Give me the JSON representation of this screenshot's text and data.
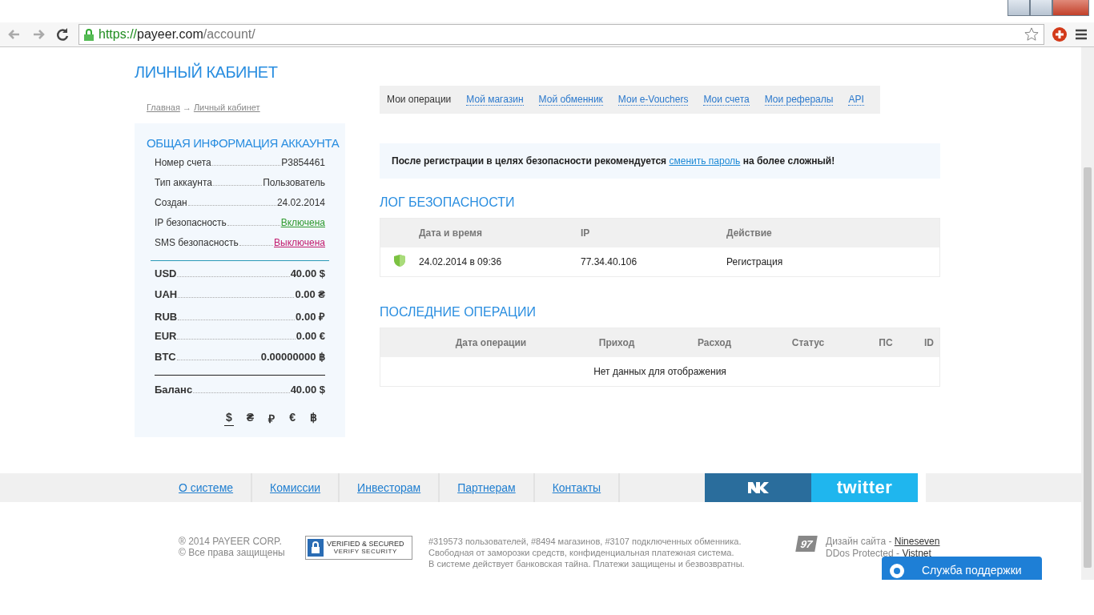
{
  "browser": {
    "url_scheme": "https://",
    "url_host": "payeer.com",
    "url_path": "/account/"
  },
  "page_title": "ЛИЧНЫЙ КАБИНЕТ",
  "breadcrumb": [
    "Главная",
    "→",
    "Личный кабинет"
  ],
  "account": {
    "title": "ОБЩАЯ ИНФОРМАЦИЯ АККАУНТА",
    "info": [
      {
        "label": "Номер счета",
        "value": "P3854461",
        "kind": "text"
      },
      {
        "label": "Тип аккаунта",
        "value": "Пользователь",
        "kind": "text"
      },
      {
        "label": "Создан",
        "value": "24.02.2014",
        "kind": "text"
      },
      {
        "label": "IP безопасность",
        "value": "Включена",
        "kind": "on"
      },
      {
        "label": "SMS безопасность",
        "value": "Выключена",
        "kind": "off"
      }
    ],
    "balances": [
      {
        "currency": "USD",
        "amount": "40.00 $"
      },
      {
        "currency": "UAH",
        "amount": "0.00 ₴"
      },
      {
        "currency": "RUB",
        "amount": "0.00 ₽"
      },
      {
        "currency": "EUR",
        "amount": "0.00 €"
      },
      {
        "currency": "BTC",
        "amount": "0.00000000 ฿"
      }
    ],
    "total": {
      "label": "Баланс",
      "amount": "40.00 $"
    },
    "currency_switch": [
      {
        "symbol": "$",
        "selected": true
      },
      {
        "symbol": "₴",
        "selected": false
      },
      {
        "symbol": "₽",
        "selected": false
      },
      {
        "symbol": "€",
        "selected": false
      },
      {
        "symbol": "฿",
        "selected": false
      }
    ]
  },
  "tabs": [
    {
      "label": "Мои операции",
      "selected": true
    },
    {
      "label": "Мой магазин",
      "selected": false
    },
    {
      "label": "Мой обменник",
      "selected": false
    },
    {
      "label": "Мои e-Vouchers",
      "selected": false
    },
    {
      "label": "Мои счета",
      "selected": false
    },
    {
      "label": "Мои рефералы",
      "selected": false
    },
    {
      "label": "API",
      "selected": false
    }
  ],
  "alert": {
    "before": "После регистрации в целях безопасности рекомендуется",
    "link": "сменить пароль",
    "after": "на более сложный!"
  },
  "security_log": {
    "title": "ЛОГ БЕЗОПАСНОСТИ",
    "columns": [
      "Дата и время",
      "IP",
      "Действие"
    ],
    "rows": [
      {
        "date": "24.02.2014 в 09:36",
        "ip": "77.34.40.106",
        "action": "Регистрация"
      }
    ]
  },
  "operations": {
    "title": "ПОСЛЕДНИЕ ОПЕРАЦИИ",
    "columns": [
      "Дата операции",
      "Приход",
      "Расход",
      "Статус",
      "ПС",
      "ID"
    ],
    "empty": "Нет данных для отображения"
  },
  "footer": {
    "links": [
      "О системе",
      "Комиссии",
      "Инвесторам",
      "Партнерам",
      "Контакты"
    ],
    "social": [
      "twitter"
    ],
    "copyright": [
      "® 2014 PAYEER CORP.",
      "© Все права защищены"
    ],
    "badge": {
      "title": "VERIFIED & SECURED",
      "subtitle": "VERIFY SECURITY"
    },
    "stats": [
      "#319573 пользователей, #8494 магазинов, #3107 подключенных обменника.",
      "Свободная от заморозки средств, конфиденциальная платежная система.",
      "В системе действует банковская тайна. Платежи защищены и безвозвратны."
    ],
    "logo_mark": "97",
    "credits": [
      {
        "label": "Дизайн сайта -",
        "link": "Nineseven"
      },
      {
        "label": "DDos Protected -",
        "link": "Vistnet"
      }
    ]
  },
  "support_button": "Служба поддержки"
}
